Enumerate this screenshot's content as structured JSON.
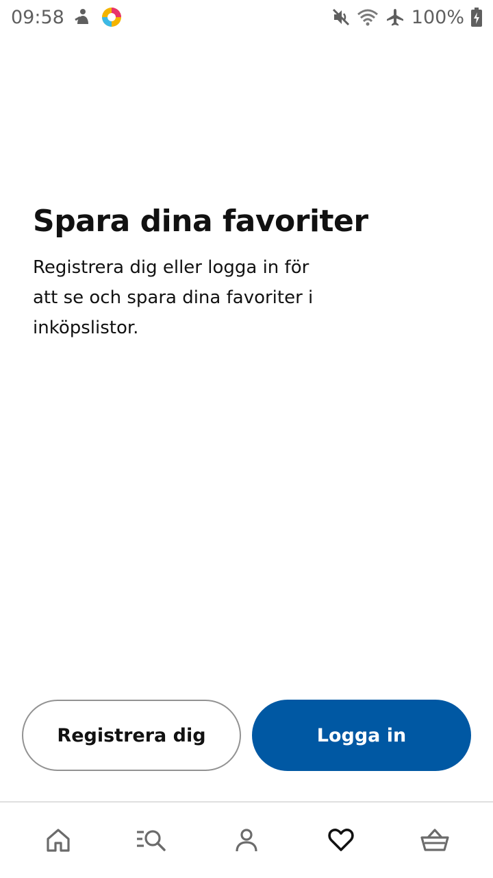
{
  "status_bar": {
    "time": "09:58",
    "battery": "100%",
    "icons": [
      "notification-icon",
      "app-logo-icon",
      "mute-icon",
      "wifi-icon",
      "airplane-mode-icon",
      "battery-charging-icon"
    ]
  },
  "favorites": {
    "title": "Spara dina favoriter",
    "description": "Registrera dig eller logga in för att se och spara dina favoriter i inköpslistor."
  },
  "actions": {
    "register_label": "Registrera dig",
    "login_label": "Logga in"
  },
  "bottom_nav": {
    "items": [
      {
        "icon": "home-icon",
        "active": false
      },
      {
        "icon": "search-list-icon",
        "active": false
      },
      {
        "icon": "profile-icon",
        "active": false
      },
      {
        "icon": "heart-icon",
        "active": true
      },
      {
        "icon": "basket-icon",
        "active": false
      }
    ]
  },
  "colors": {
    "primary": "#0058a3",
    "text": "#111111",
    "icon_inactive": "#6b6b6b",
    "icon_active": "#111111",
    "divider": "#dfdfdf"
  }
}
